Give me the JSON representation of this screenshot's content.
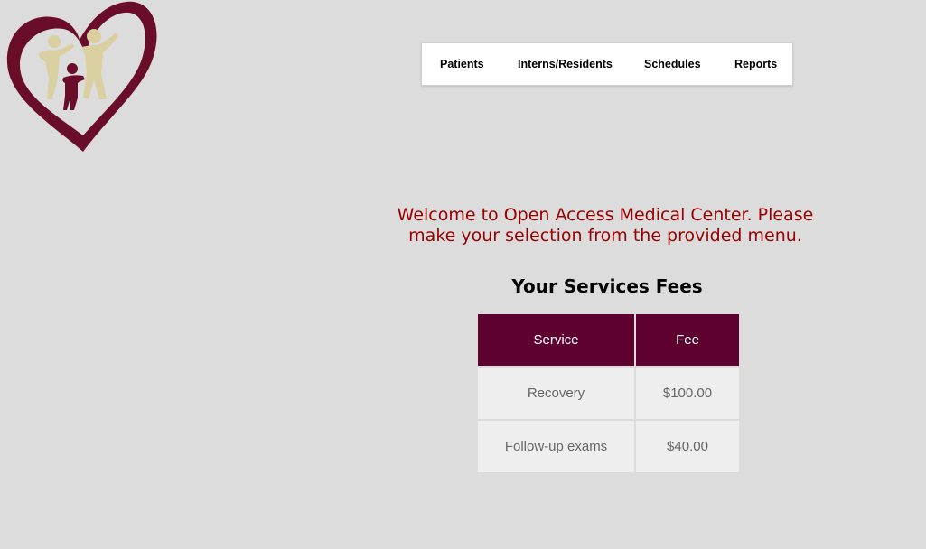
{
  "logo": {
    "icon": "family-heart-logo",
    "colors": {
      "heart": "#6a0d2a",
      "figures_light": "#d9cfa0",
      "figure_child": "#6a0d2a"
    }
  },
  "menu": {
    "items": [
      {
        "label": "Patients"
      },
      {
        "label": "Interns/Residents"
      },
      {
        "label": "Schedules"
      },
      {
        "label": "Reports"
      }
    ]
  },
  "main": {
    "welcome_line1": "Welcome to Open Access Medical Center. Please",
    "welcome_line2": "make your selection from the provided menu.",
    "table_title": "Your Services Fees",
    "table": {
      "headers": [
        "Service",
        "Fee"
      ],
      "rows": [
        [
          "Recovery",
          "$100.00"
        ],
        [
          "Follow-up exams",
          "$40.00"
        ]
      ]
    }
  },
  "colors": {
    "background": "#dcdcdc",
    "accent": "#5e0030",
    "welcome_text": "#990000",
    "cell_bg": "#eeeeee",
    "cell_text": "#666666"
  }
}
